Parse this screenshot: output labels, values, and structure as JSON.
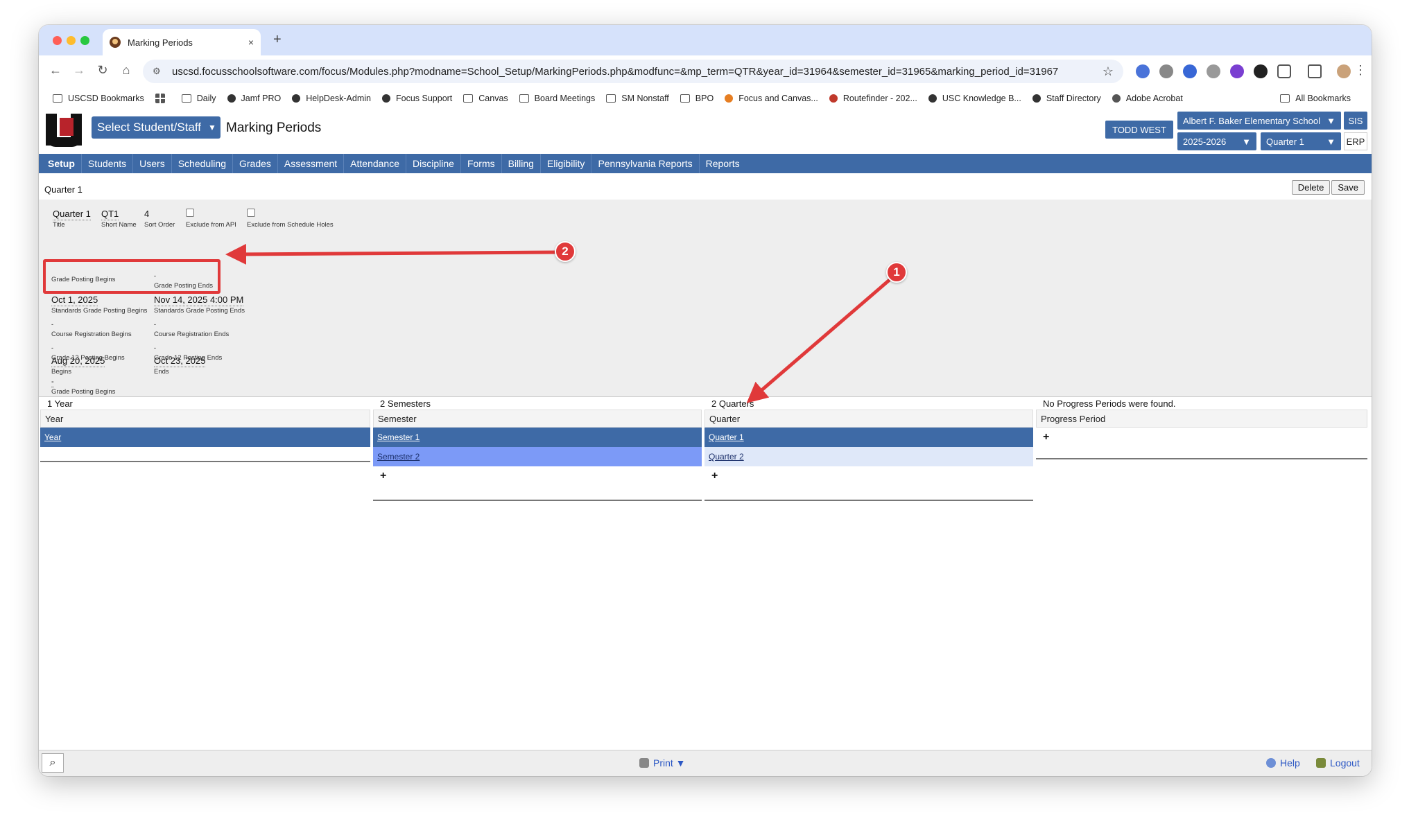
{
  "browser": {
    "tab_title": "Marking Periods",
    "new_tab": "+",
    "tab_close": "×",
    "url": "uscsd.focusschoolsoftware.com/focus/Modules.php?modname=School_Setup/MarkingPeriods.php&modfunc=&mp_term=QTR&year_id=31964&semester_id=31965&marking_period_id=31967"
  },
  "bookmarks": {
    "items": [
      "USCSD Bookmarks",
      "Daily",
      "Jamf PRO",
      "HelpDesk-Admin",
      "Focus Support",
      "Canvas",
      "Board Meetings",
      "SM Nonstaff",
      "BPO",
      "Focus and Canvas...",
      "Routefinder - 202...",
      "USC Knowledge B...",
      "Staff Directory",
      "Adobe Acrobat"
    ],
    "all": "All Bookmarks"
  },
  "header": {
    "select_label": "Select Student/Staff",
    "page_title": "Marking Periods",
    "user": "TODD WEST",
    "school": "Albert F. Baker Elementary School",
    "year": "2025-2026",
    "quarter": "Quarter 1",
    "sis": "SIS",
    "erp": "ERP"
  },
  "menu": [
    "Setup",
    "Students",
    "Users",
    "Scheduling",
    "Grades",
    "Assessment",
    "Attendance",
    "Discipline",
    "Forms",
    "Billing",
    "Eligibility",
    "Pennsylvania Reports",
    "Reports"
  ],
  "subtitle": "Quarter 1",
  "actions": {
    "delete": "Delete",
    "save": "Save"
  },
  "form": {
    "title": {
      "value": "Quarter 1",
      "label": "Title"
    },
    "short_name": {
      "value": "QT1",
      "label": "Short Name"
    },
    "sort_order": {
      "value": "4",
      "label": "Sort Order"
    },
    "exclude_api": {
      "label": "Exclude from API"
    },
    "exclude_holes": {
      "label": "Exclude from Schedule Holes"
    },
    "begins": {
      "value": "Aug 20, 2025",
      "label": "Begins"
    },
    "ends": {
      "value": "Oct 23, 2025",
      "label": "Ends"
    },
    "grade_posting_begins": {
      "value": "-",
      "label": "Grade Posting Begins"
    },
    "grade_posting_ends": {
      "value": "-",
      "label": "Grade Posting Ends"
    },
    "std_grade_posting_begins": {
      "value": "Oct 1, 2025",
      "label": "Standards Grade Posting Begins"
    },
    "std_grade_posting_ends": {
      "value": "Nov 14, 2025 4:00 PM",
      "label": "Standards Grade Posting Ends"
    },
    "course_reg_begins": {
      "value": "-",
      "label": "Course Registration Begins"
    },
    "course_reg_ends": {
      "value": "-",
      "label": "Course Registration Ends"
    },
    "grade12_begins": {
      "value": "-",
      "label": "Grade 12 Posting Begins"
    },
    "grade12_ends": {
      "value": "-",
      "label": "Grade 12 Posting Ends"
    }
  },
  "lists": {
    "years": {
      "count": "1 Year",
      "header": "Year",
      "rows": [
        "Year"
      ]
    },
    "semesters": {
      "count": "2 Semesters",
      "header": "Semester",
      "rows": [
        "Semester 1",
        "Semester 2"
      ],
      "add": "+"
    },
    "quarters": {
      "count": "2 Quarters",
      "header": "Quarter",
      "rows": [
        "Quarter 1",
        "Quarter 2"
      ],
      "add": "+"
    },
    "progress": {
      "count": "No Progress Periods were found.",
      "header": "Progress Period",
      "add": "+"
    }
  },
  "footer": {
    "print": "Print ▼",
    "help": "Help",
    "logout": "Logout"
  },
  "annotations": {
    "badge1": "1",
    "badge2": "2"
  }
}
